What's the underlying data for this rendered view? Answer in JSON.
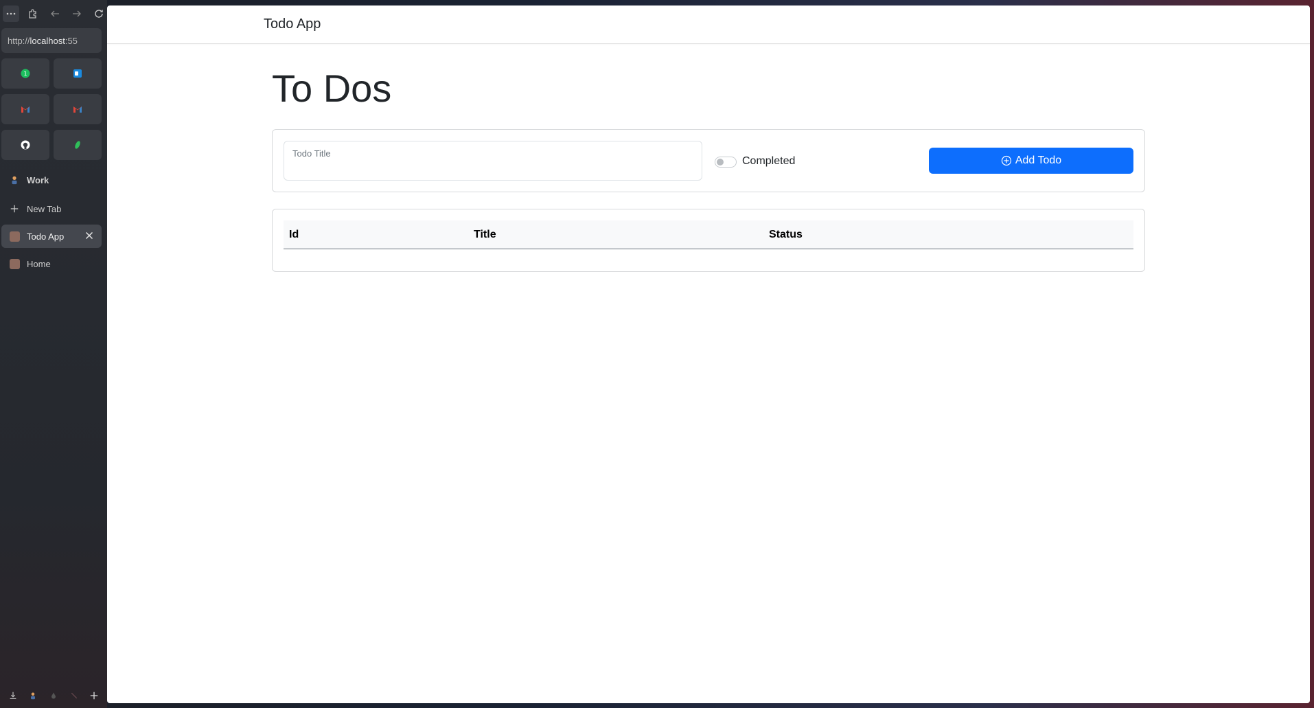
{
  "browser": {
    "url_prefix": "http://",
    "url_host": "localhost",
    "url_rest": ":55",
    "pinned": [
      {
        "icon": "password-manager-icon",
        "color": "#1dbf5f"
      },
      {
        "icon": "outlook-icon",
        "color": "#1a8be0"
      },
      {
        "icon": "gmail-icon",
        "color": "#e2463a"
      },
      {
        "icon": "gmail-icon",
        "color": "#e2463a"
      },
      {
        "icon": "github-icon",
        "color": "#ffffff"
      },
      {
        "icon": "leaf-icon",
        "color": "#2fbf5a"
      }
    ],
    "space_label": "Work",
    "new_tab_label": "New Tab",
    "tabs": [
      {
        "label": "Todo App",
        "active": true
      },
      {
        "label": "Home",
        "active": false
      }
    ]
  },
  "app": {
    "brand": "Todo App",
    "page_title": "To Dos",
    "form": {
      "title_placeholder": "Todo Title",
      "completed_label": "Completed",
      "completed_checked": false,
      "add_button_label": "Add Todo"
    },
    "table": {
      "headers": [
        "Id",
        "Title",
        "Status"
      ],
      "rows": []
    },
    "colors": {
      "primary": "#0d6efd",
      "text": "#212529"
    }
  }
}
